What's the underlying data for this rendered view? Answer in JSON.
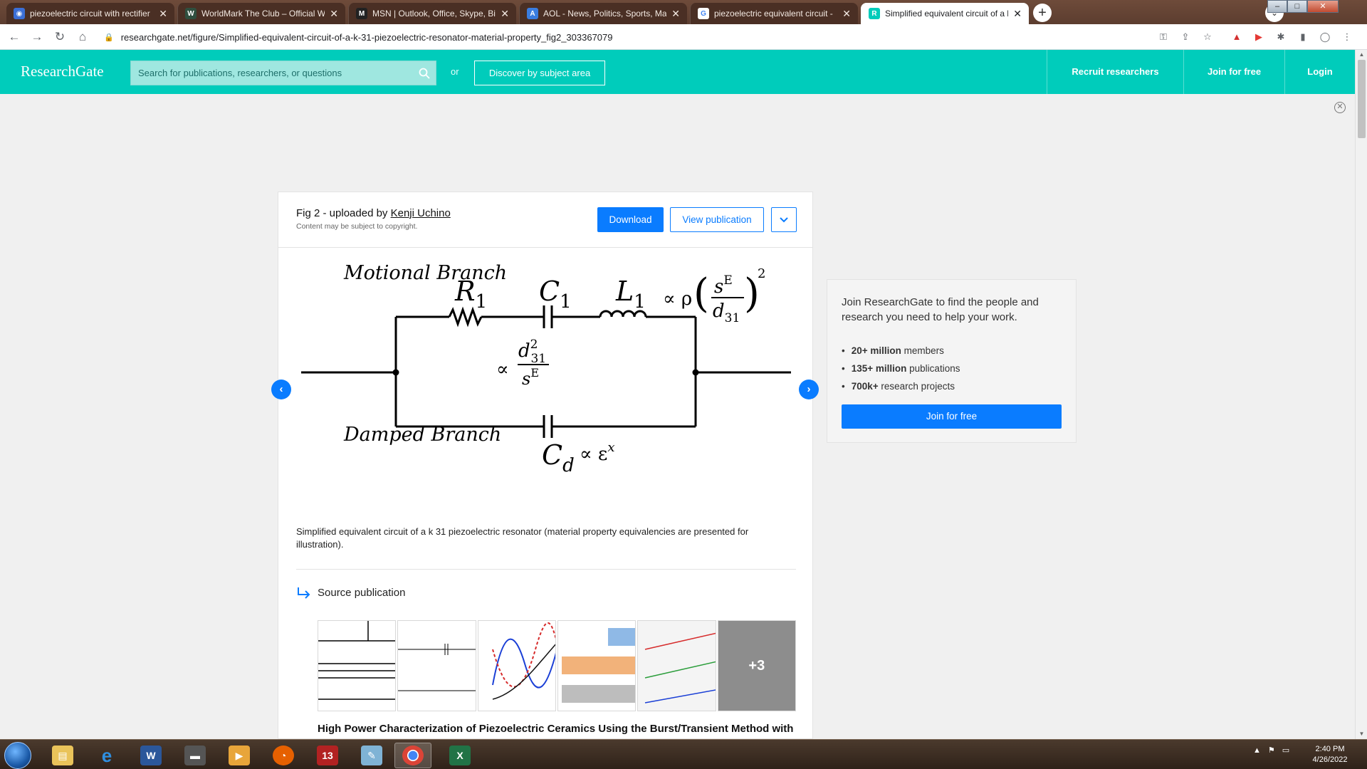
{
  "browser": {
    "tabs": [
      {
        "title": "piezoelectric circuit with rectifier",
        "icon": "chat-icon",
        "color": "#3b6fd6"
      },
      {
        "title": "WorldMark The Club – Official W...",
        "icon": "worldmark-icon",
        "color": "#2f4f3f"
      },
      {
        "title": "MSN | Outlook, Office, Skype, Bin",
        "icon": "msn-icon",
        "color": "#222222"
      },
      {
        "title": "AOL - News, Politics, Sports, Mai",
        "icon": "aol-icon",
        "color": "#3a7de0"
      },
      {
        "title": "piezoelectric equivalent circuit - ",
        "icon": "google-icon",
        "color": "#4285f4"
      },
      {
        "title": "Simplified equivalent circuit of a k",
        "icon": "researchgate-icon",
        "color": "#00ccbb"
      }
    ],
    "url": "researchgate.net/figure/Simplified-equivalent-circuit-of-a-k-31-piezoelectric-resonator-material-property_fig2_303367079"
  },
  "header": {
    "logo": "ResearchGate",
    "search_placeholder": "Search for publications, researchers, or questions",
    "or_label": "or",
    "discover_label": "Discover by subject area",
    "recruit_label": "Recruit researchers",
    "join_label": "Join for free",
    "login_label": "Login"
  },
  "figure": {
    "title_prefix": "Fig 2 - uploaded by ",
    "uploader": "Kenji Uchino",
    "copyright": "Content may be subject to copyright.",
    "download_label": "Download",
    "view_label": "View publication",
    "caption": "Simplified equivalent circuit of a k 31 piezoelectric resonator (material property equivalencies are presented for illustration).",
    "diagram": {
      "motional_branch": "Motional Branch",
      "damped_branch": "Damped Branch",
      "r1": "R",
      "r1_sub": "1",
      "c1": "C",
      "c1_sub": "1",
      "l1": "L",
      "l1_sub": "1",
      "l1_prop": "∝ ρ",
      "l1_frac_num": "s",
      "l1_frac_num_sup": "E",
      "l1_frac_den": "d",
      "l1_frac_den_sub": "31",
      "l1_power": "2",
      "c1_prop": "∝",
      "c1_frac_num": "d",
      "c1_frac_num_sup": "2",
      "c1_frac_num_sub": "31",
      "c1_frac_den": "s",
      "c1_frac_den_sup": "E",
      "cd": "C",
      "cd_sub": "d",
      "cd_prop": "∝ ε",
      "cd_sup": "x"
    },
    "source_heading": "Source publication",
    "more_figures": "+3",
    "publication_title": "High Power Characterization of Piezoelectric Ceramics Using the Burst/Transient Method with Resonance and Antiresonance Analysis"
  },
  "promo": {
    "text": "Join ResearchGate to find the people and research you need to help your work.",
    "stats": [
      {
        "bold": "20+ million",
        "rest": " members"
      },
      {
        "bold": "135+ million",
        "rest": " publications"
      },
      {
        "bold": "700k+",
        "rest": " research projects"
      }
    ],
    "button": "Join for free"
  },
  "taskbar": {
    "time": "2:40 PM",
    "date": "4/26/2022",
    "apps": [
      "explorer",
      "internet-explorer",
      "word",
      "media",
      "media-player",
      "firefox",
      "calendar",
      "notepad",
      "chrome",
      "excel"
    ]
  },
  "colors": {
    "brand": "#00ccbb",
    "accent": "#0a7cff"
  }
}
